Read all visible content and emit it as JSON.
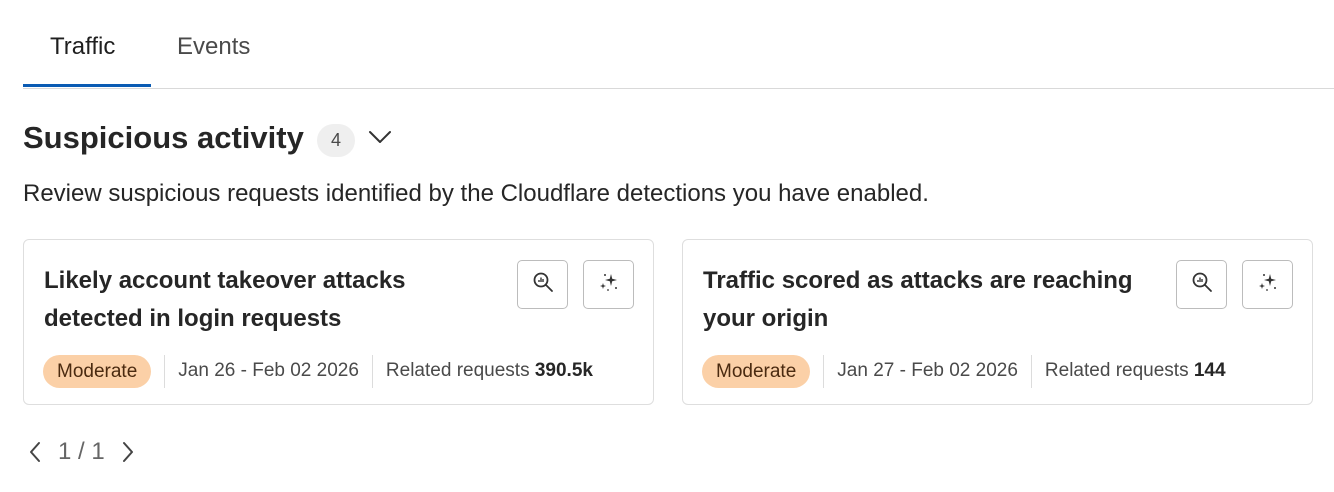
{
  "tabs": [
    {
      "label": "Traffic",
      "active": true
    },
    {
      "label": "Events",
      "active": false
    }
  ],
  "section": {
    "title": "Suspicious activity",
    "count": "4",
    "description": "Review suspicious requests identified by the Cloudflare detections you have enabled."
  },
  "cards": [
    {
      "title": "Likely account takeover attacks detected in login requests",
      "severity": "Moderate",
      "date_range": "Jan 26 - Feb 02 2026",
      "related_label": "Related requests",
      "related_value": "390.5k",
      "icons": [
        "analytics-search-icon",
        "sparkle-icon"
      ]
    },
    {
      "title": "Traffic scored as attacks are reaching your origin",
      "severity": "Moderate",
      "date_range": "Jan 27 - Feb 02 2026",
      "related_label": "Related requests",
      "related_value": "144",
      "icons": [
        "analytics-search-icon",
        "sparkle-icon"
      ]
    }
  ],
  "pagination": {
    "text": "1 / 1"
  },
  "colors": {
    "accent": "#0a5bb3",
    "severity_moderate_bg": "#fbd0a7"
  }
}
